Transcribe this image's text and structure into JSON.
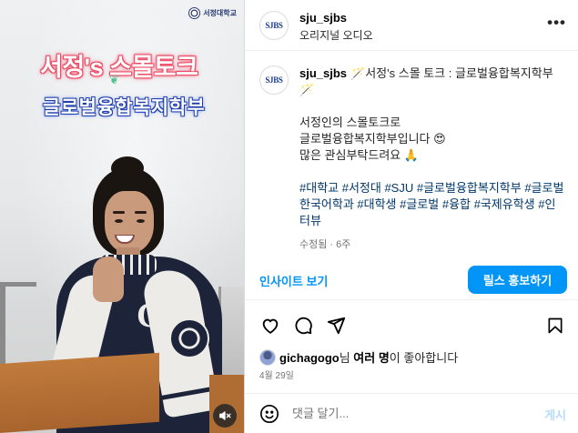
{
  "media": {
    "overlay_title": "서정's 스몰토크",
    "overlay_subtitle": "글로벌융합복지학부",
    "corner_logo_text": "서정대학교",
    "mute_icon": "speaker-muted-icon"
  },
  "header": {
    "username": "sju_sjbs",
    "audio_label": "오리지널 오디오",
    "avatar_text": "SJBS",
    "more_icon": "more-horizontal-icon"
  },
  "caption": {
    "username": "sju_sjbs",
    "title": "🪄서정's 스몰 토크 : 글로벌융합복지학부 🪄",
    "line1": "서정인의 스몰토크로",
    "line2": "글로벌융합복지학부입니다 😍",
    "line3": "많은 관심부탁드려요 🙏",
    "hashtags": "#대학교 #서정대 #SJU #글로벌융합복지학부 #글로벌한국어학과 #대학생 #글로벌 #융합 #국제유학생 #인터뷰",
    "edited": "수정됨 · 6주"
  },
  "insights": {
    "link_label": "인사이트 보기",
    "boost_label": "릴스 홍보하기"
  },
  "actions": {
    "like_icon": "heart-icon",
    "comment_icon": "comment-icon",
    "share_icon": "share-icon",
    "save_icon": "bookmark-icon"
  },
  "likes": {
    "user": "gichagogo",
    "suffix1": "님 ",
    "others": "여러 명",
    "suffix2": "이 좋아합니다"
  },
  "date": "4월 29일",
  "comment": {
    "placeholder": "댓글 달기...",
    "post_label": "게시",
    "emoji_icon": "smiley-icon"
  },
  "colors": {
    "accent": "#0095f6",
    "hashtag": "#00376b",
    "muted_text": "#737373",
    "post_disabled": "#b3dbff"
  }
}
